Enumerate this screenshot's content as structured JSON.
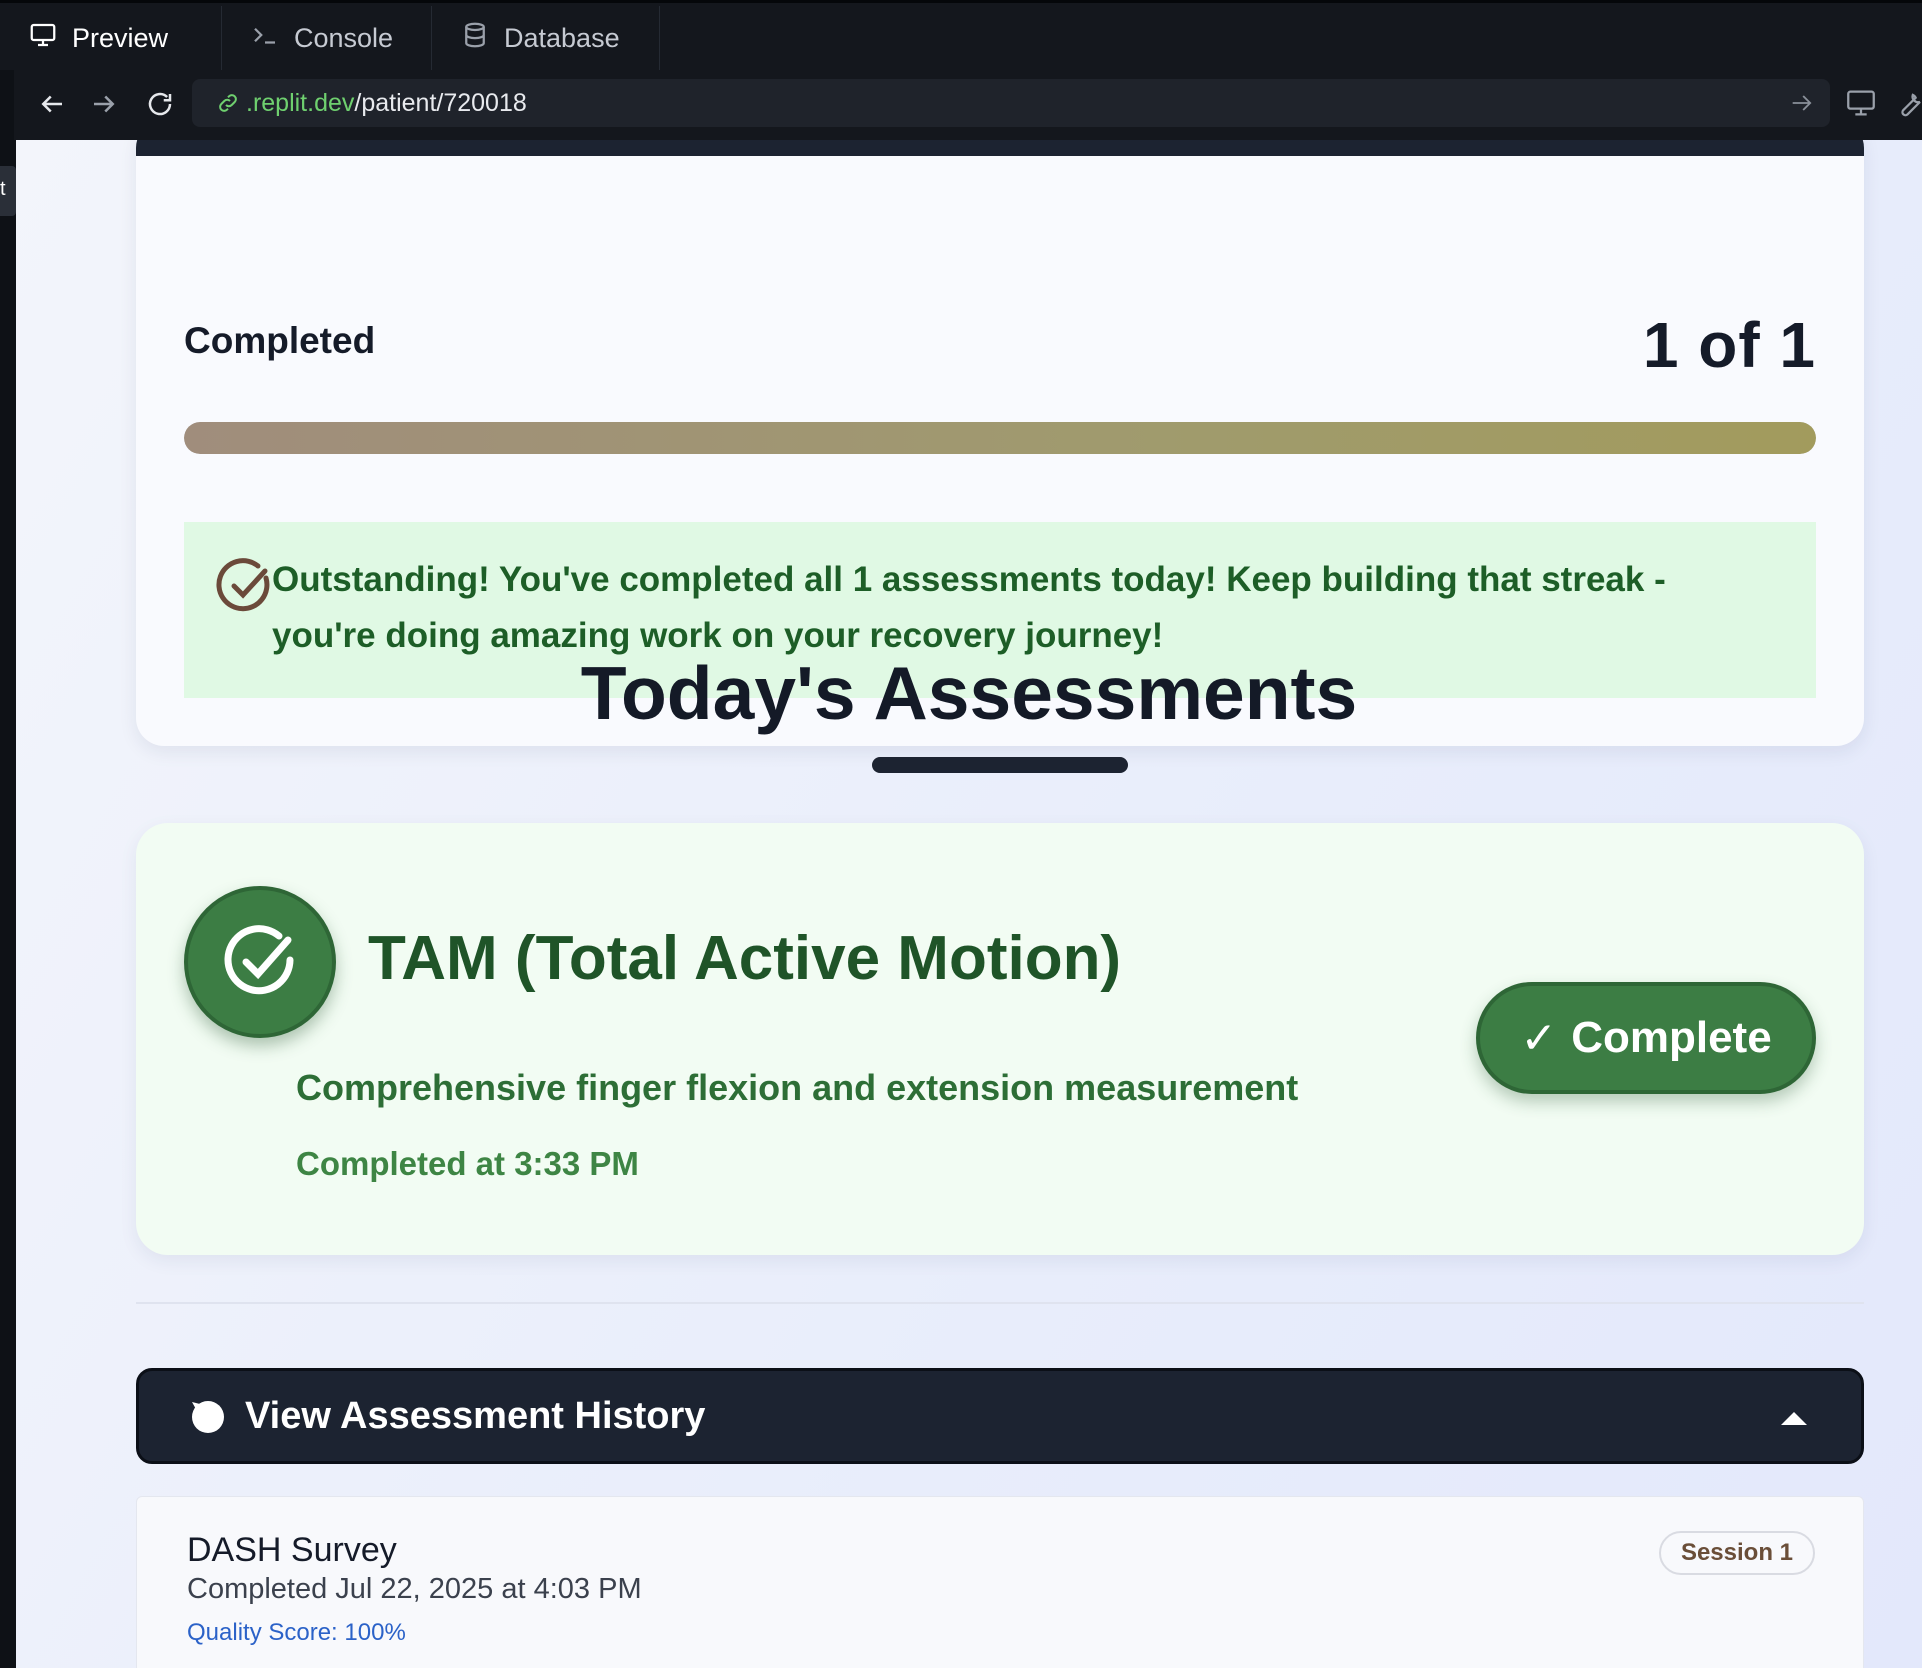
{
  "browser": {
    "tabs": [
      {
        "label": "Preview",
        "icon": "monitor-icon"
      },
      {
        "label": "Console",
        "icon": "terminal-icon"
      },
      {
        "label": "Database",
        "icon": "database-icon"
      }
    ],
    "url_host": ".replit.dev",
    "url_path": "/patient/720018",
    "left_tag": "t"
  },
  "progress": {
    "label": "Completed",
    "count_text": "1 of 1",
    "fraction_complete": 1.0,
    "banner_text": "Outstanding! You've completed all 1 assessments today! Keep building that streak - you're doing amazing work on your recovery journey!"
  },
  "section": {
    "title": "Today's Assessments"
  },
  "assessment": {
    "title": "TAM (Total Active Motion)",
    "description": "Comprehensive finger flexion and extension measurement",
    "completed_time": "Completed at 3:33 PM",
    "button_label": "Complete",
    "button_check": "✓"
  },
  "history": {
    "toggle_label": "View Assessment History",
    "items": [
      {
        "title": "DASH Survey",
        "date": "Completed Jul 22, 2025 at 4:03 PM",
        "score": "Quality Score: 100%",
        "badge": "Session 1"
      }
    ]
  },
  "colors": {
    "accent_green": "#3c7d44",
    "banner_bg": "#e0f9e4",
    "dark_navy": "#1c2331",
    "progress_fill_start": "#a08d7c",
    "progress_fill_end": "#a29b5d"
  }
}
